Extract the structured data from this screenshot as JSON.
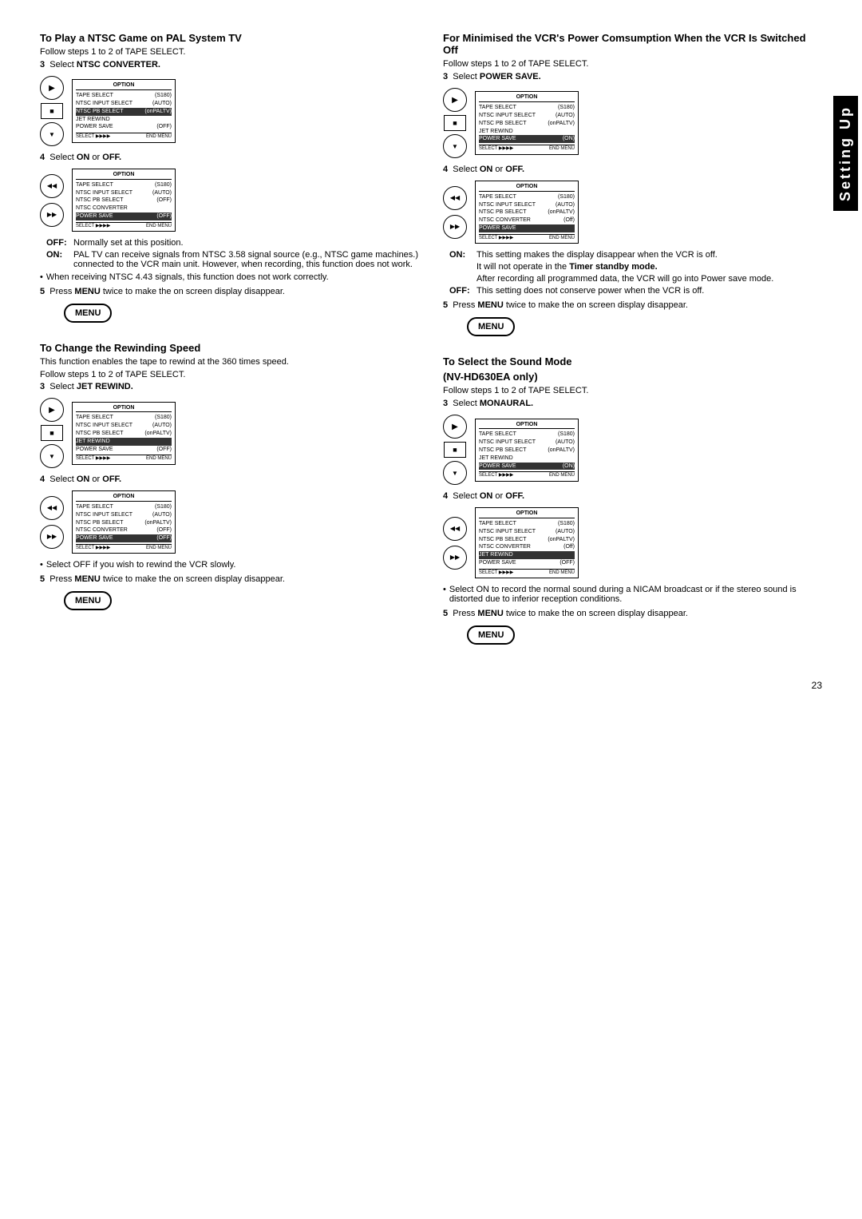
{
  "left_col": {
    "section1": {
      "title": "To Play a NTSC Game on PAL System TV",
      "subtitle": "Follow steps 1 to 2 of TAPE SELECT.",
      "step3": "Select NTSC CONVERTER.",
      "step4": "Select ON or OFF.",
      "off_label": "OFF:",
      "off_text": "Normally set at this position.",
      "on_label": "ON:",
      "on_text": "PAL TV can receive signals from NTSC 3.58 signal source (e.g., NTSC game machines.) connected to the VCR main unit. However, when recording, this function does not work.",
      "bullet1": "When receiving NTSC 4.43 signals, this function does not work correctly.",
      "step5": "Press MENU twice to make the on screen display disappear."
    },
    "section2": {
      "title": "To Change the Rewinding Speed",
      "subtitle": "This function enables the tape to rewind at the 360 times speed.",
      "follow": "Follow steps 1 to 2 of TAPE SELECT.",
      "step3": "Select JET REWIND.",
      "step4": "Select ON or OFF.",
      "bullet1": "Select OFF if you wish to rewind the VCR slowly.",
      "step5": "Press MENU twice to make the on screen display disappear."
    }
  },
  "right_col": {
    "section1": {
      "title": "For Minimised the VCR's Power Comsumption When the VCR Is Switched Off",
      "subtitle": "Follow steps 1 to 2 of TAPE SELECT.",
      "step3": "Select POWER SAVE.",
      "step4": "Select ON or OFF.",
      "on_label": "ON:",
      "on_text": "This setting makes the display disappear when the VCR is off.",
      "on_text2": "It will not operate in the Timer standby mode.",
      "on_text3": "After recording all programmed data, the VCR will go into Power save mode.",
      "off_label": "OFF:",
      "off_text": "This setting does not conserve power when the VCR is off.",
      "step5": "Press MENU twice to make the on screen display disappear."
    },
    "section2": {
      "title": "To Select the Sound Mode",
      "title2": "(NV-HD630EA only)",
      "subtitle": "Follow steps 1 to 2 of TAPE SELECT.",
      "step3": "Select MONAURAL.",
      "step4": "Select ON or OFF.",
      "bullet1": "Select ON to record the normal sound during a NICAM broadcast or if the stereo sound is distorted due to inferior reception conditions.",
      "step5": "Press MENU twice to make the on screen display disappear."
    }
  },
  "option_menu": {
    "title": "OPTION",
    "rows": [
      {
        "label": "TAPE SELECT",
        "value": "(S180)"
      },
      {
        "label": "NTSC INPUT SELECT",
        "value": "(AUTO)"
      },
      {
        "label": "NTSC PB SELECT",
        "value": "(onPALTV)"
      },
      {
        "label": "JET REWIND",
        "value": ""
      },
      {
        "label": "POWER SAVE",
        "value": "(OFF)"
      }
    ],
    "footer_left": "SELECT ▶▶▶▶",
    "footer_right": "END MENU"
  },
  "option_menu2": {
    "title": "OPTION",
    "rows": [
      {
        "label": "TAPE SELECT",
        "value": "(S180)"
      },
      {
        "label": "NTSC INPUT SELECT",
        "value": "(AUTO)"
      },
      {
        "label": "NTSC PB SELECT",
        "value": "(OFF)"
      },
      {
        "label": "JET REWIND",
        "value": ""
      },
      {
        "label": "POWER SAVE",
        "value": "(OFF)"
      }
    ],
    "footer_left": "SELECT ▶▶▶▶",
    "footer_right": "END MENU"
  },
  "menu_button_label": "MENU",
  "page_number": "23",
  "side_label": "Setting Up"
}
